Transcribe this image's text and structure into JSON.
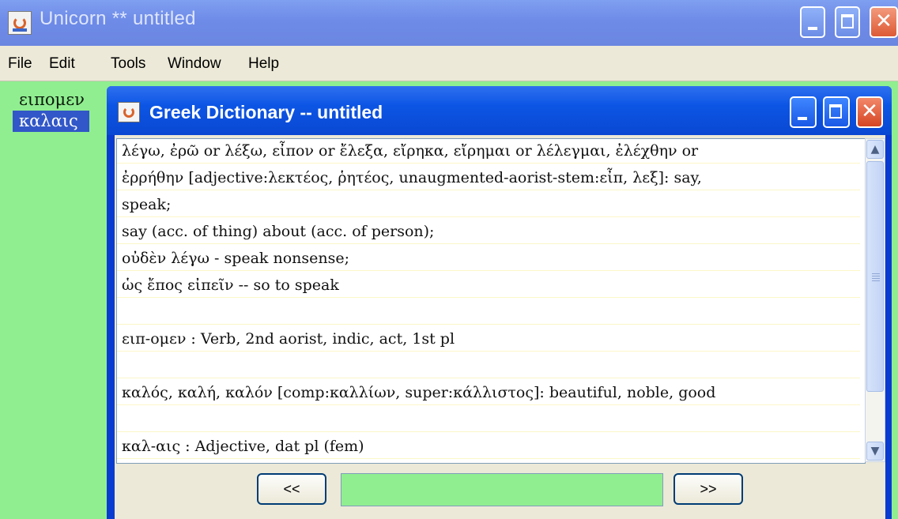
{
  "app": {
    "title": "Unicorn  **  untitled"
  },
  "menu": {
    "items": [
      "File",
      "Edit",
      "Tools",
      "Window",
      "Help"
    ]
  },
  "wordlist": {
    "items": [
      {
        "text": "ειπομεν",
        "selected": false
      },
      {
        "text": "καλαις",
        "selected": true
      }
    ]
  },
  "dictionary": {
    "title": "Greek Dictionary -- untitled",
    "lines": [
      "λέγω, ἐρῶ or λέξω, εἶπον or ἔλεξα, εἴρηκα, εἴρημαι or λέλεγμαι, ἐλέχθην or",
      "ἐρρήθην [adjective:λεκτέος, ῥητέος, unaugmented-aorist-stem:εἶπ, λεξ]:  say,",
      "speak;",
      "  say (acc. of thing) about (acc. of person);",
      "  οὐδὲν λέγω - speak nonsense;",
      "  ὡς ἔπος εἰπεῖν -- so to speak",
      "",
      "  ειπ-ομεν : Verb, 2nd aorist, indic, act, 1st pl",
      "",
      "καλός, καλή, καλόν [comp:καλλίων, super:κάλλιστος]:  beautiful, noble, good",
      "",
      "  καλ-αις : Adjective, dat pl (fem)"
    ],
    "prev_label": "<<",
    "next_label": ">>",
    "nav_field_value": "",
    "field_color": "#90ee90"
  },
  "colors": {
    "outer_titlebar": "#6e8be8",
    "inner_titlebar": "#0c55e4",
    "background": "#90ee90",
    "selection": "#3157c8"
  }
}
